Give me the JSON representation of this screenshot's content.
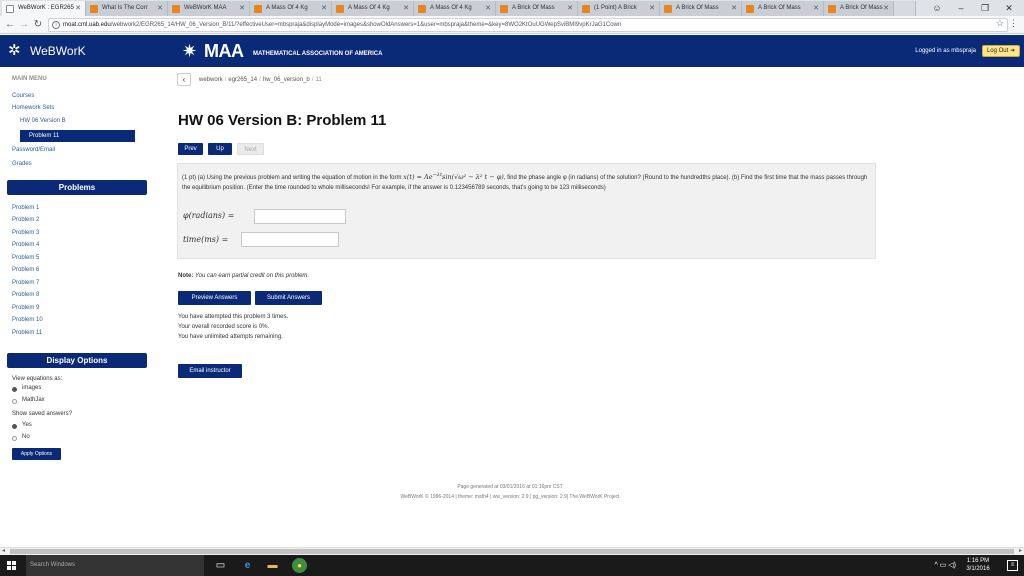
{
  "browser": {
    "tabs": [
      {
        "label": "WeBWorK : EGR265",
        "active": true
      },
      {
        "label": "What Is The Corr"
      },
      {
        "label": "WeBWorK MAA"
      },
      {
        "label": "A Mass Of 4 Kg"
      },
      {
        "label": "A Mass Of 4 Kg"
      },
      {
        "label": "A Mass Of 4 Kg"
      },
      {
        "label": "A Brick Of Mass"
      },
      {
        "label": "(1 Point) A Brick"
      },
      {
        "label": "A Brick Of Mass"
      },
      {
        "label": "A Brick Of Mass"
      },
      {
        "label": "A Brick Of Mass"
      }
    ],
    "url_host": "moat.cml.uab.edu",
    "url_path": "/webwork2/EGR265_14/HW_06_Version_B/11/?effectiveUser=mbspraja&displayMode=images&showOldAnswers=1&user=mbspraja&theme=&key=8WO2KtOuUGWepSviBMI9vpKrJaG1Cown",
    "win_controls": {
      "minimize": "–",
      "maximize": "❐",
      "close": "✕"
    }
  },
  "header": {
    "app_name": "WeBWorK",
    "maa_big": "MAA",
    "maa_sub": "MATHEMATICAL ASSOCIATION OF AMERICA",
    "logged_in": "Logged in as mbspraja",
    "logout": "Log Out ➜"
  },
  "sidebar": {
    "main_menu": "MAIN MENU",
    "links": {
      "courses": "Courses",
      "homework_sets": "Homework Sets",
      "set": "HW 06 Version B",
      "problem": "Problem 11",
      "password": "Password/Email",
      "grades": "Grades"
    },
    "problems_head": "Problems",
    "problems": [
      "Problem 1",
      "Problem 2",
      "Problem 3",
      "Problem 4",
      "Problem 5",
      "Problem 6",
      "Problem 7",
      "Problem 8",
      "Problem 9",
      "Problem 10",
      "Problem 11"
    ],
    "display_head": "Display Options",
    "view_eq_label": "View equations as:",
    "view_opts": [
      "images",
      "MathJax"
    ],
    "saved_label": "Show saved answers?",
    "saved_opts": [
      "Yes",
      "No"
    ],
    "apply": "Apply Options"
  },
  "main": {
    "breadcrumb": [
      "webwork",
      "egr265_14",
      "hw_06_version_b",
      "11"
    ],
    "title": "HW 06 Version B: Problem 11",
    "buttons": {
      "prev": "Prev",
      "up": "Up",
      "next": "Next"
    },
    "problem": {
      "part1": "(1 pt) (a) Using the previous problem and writing the equation of motion in the form ",
      "math1": "x(t) = Ae",
      "math_sup": "−λt",
      "math2": "sin(√ω² − λ² t − φ)",
      "part2": ", find the phase angle φ (in radians) of the solution? (Round to the hundredths place). (b) Find the first time that the mass passes through the equilibrium position. (Enter the time rounded to whole milliseconds! For example, if the answer is 0.123456789 seconds, that's going to be 123 milliseconds)",
      "ans1_label": "φ(radians) =",
      "ans2_label": "time(ms) ="
    },
    "note_bold": "Note:",
    "note_text": "You can earn partial credit on this problem.",
    "preview": "Preview Answers",
    "submit": "Submit Answers",
    "status": [
      "You have attempted this problem 3 times.",
      "Your overall recorded score is 0%.",
      "You have unlimited attempts remaining."
    ],
    "email": "Email instructor"
  },
  "footer": {
    "line1": "Page generated at 03/01/2016 at 01:16pm CST",
    "line2": "WeBWorK © 1996-2014 | theme: math4 | ww_version: 2.9 | pg_version: 2.9| The WeBWorK Project"
  },
  "taskbar": {
    "search": "Search Windows",
    "time": "1:16 PM",
    "date": "3/1/2016"
  }
}
